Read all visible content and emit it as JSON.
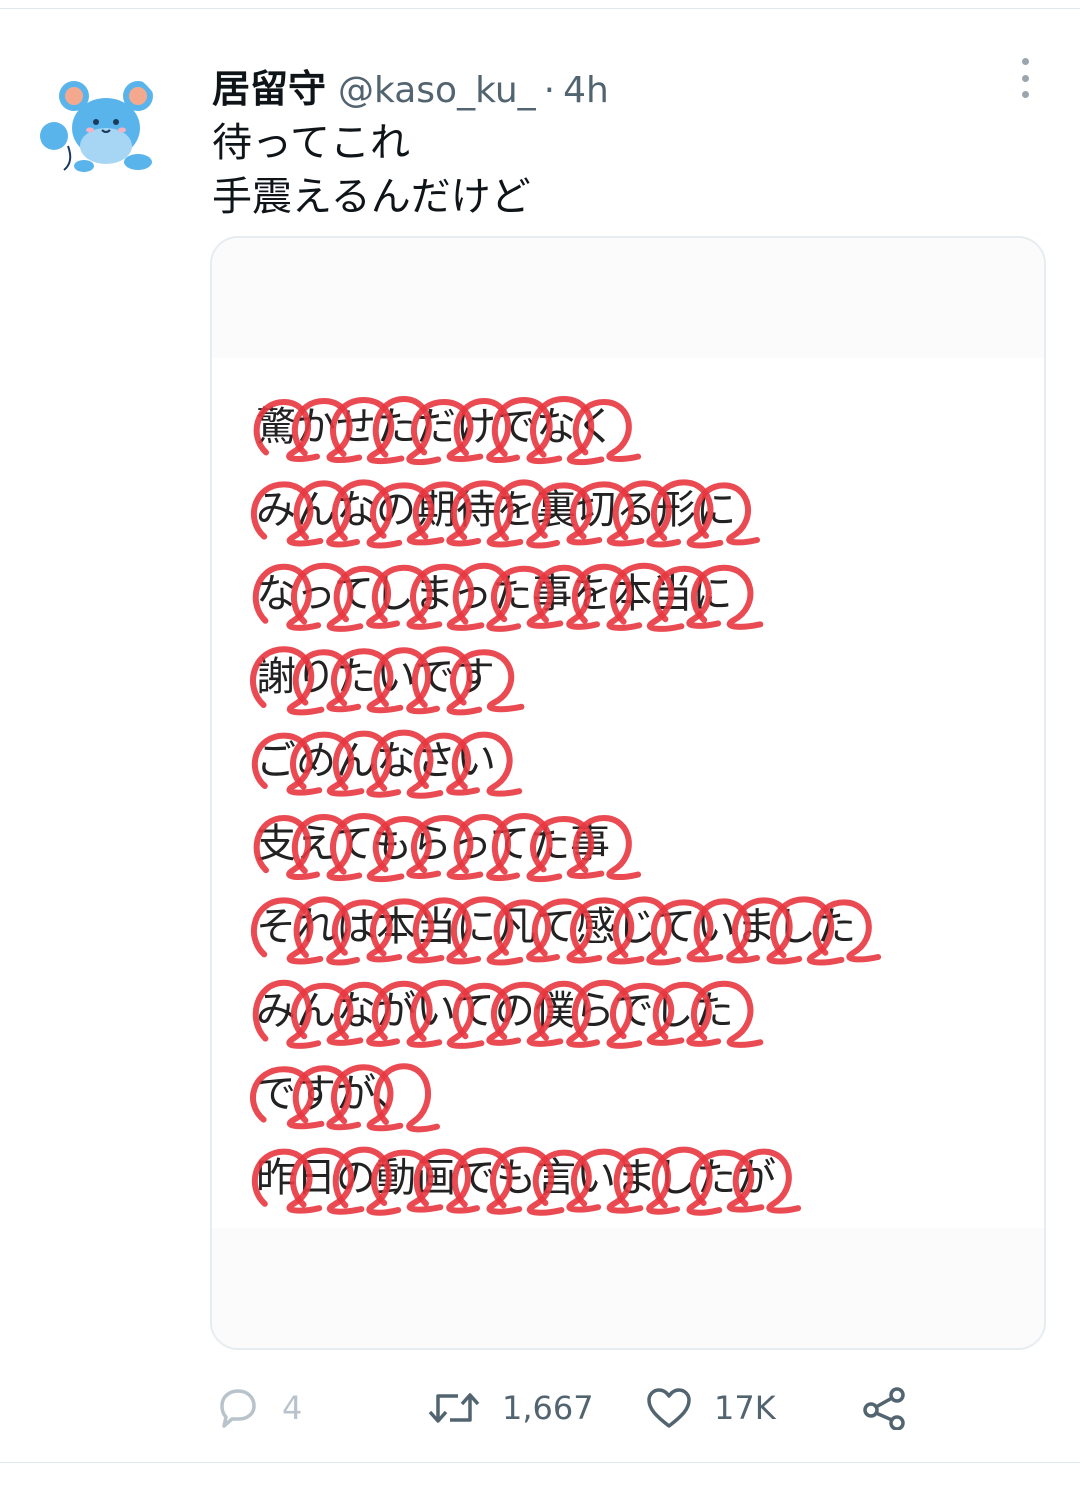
{
  "tweet": {
    "display_name": "居留守",
    "handle": "@kaso_ku_",
    "separator": "·",
    "time": "4h",
    "text_lines": [
      "待ってこれ",
      "手震えるんだけど"
    ],
    "more_icon": "more-vertical-icon"
  },
  "media": {
    "lines": [
      "驚かせただけでなく",
      "みんなの期待を裏切る形に",
      "なってしまった事を本当に",
      "謝りたいです",
      "ごめんなさい",
      "支えてもらってた事",
      "それは本当に凡て感じていました",
      "みんながいての僕らでした",
      "ですが、",
      "昨日の動画でも言いましたが"
    ],
    "scribble_color": "#e8363f"
  },
  "actions": {
    "reply": {
      "icon": "reply-icon",
      "count": "4"
    },
    "retweet": {
      "icon": "retweet-icon",
      "count": "1,667"
    },
    "like": {
      "icon": "heart-icon",
      "count": "17K"
    },
    "share": {
      "icon": "share-icon"
    }
  },
  "colors": {
    "text": "#0f1419",
    "secondary": "#536471",
    "divider": "#e1e8ed",
    "avatar_blue": "#5ab4ec",
    "avatar_ear": "#f4a98f"
  }
}
